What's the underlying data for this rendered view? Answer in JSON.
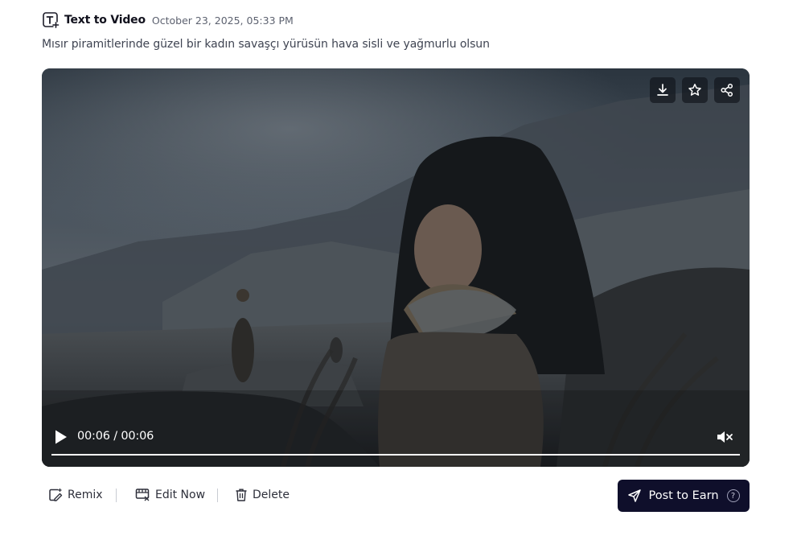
{
  "header": {
    "type_label": "Text to Video",
    "timestamp": "October 23, 2025, 05:33 PM"
  },
  "prompt": "Mısır piramitlerinde güzel bir kadın savaşçı yürüsün hava sisli ve yağmurlu olsun",
  "player": {
    "current_time": "00:06",
    "duration": "00:06",
    "time_separator": "/",
    "progress_fraction": 1.0,
    "muted": true,
    "top_actions": [
      "download-icon",
      "star-icon",
      "share-icon"
    ]
  },
  "footer": {
    "remix_label": "Remix",
    "edit_label": "Edit Now",
    "delete_label": "Delete",
    "post_label": "Post to Earn",
    "help_glyph": "?"
  },
  "colors": {
    "post_button_bg": "#0f0f2b",
    "text_primary": "#11111d",
    "text_secondary": "#5d6270"
  }
}
